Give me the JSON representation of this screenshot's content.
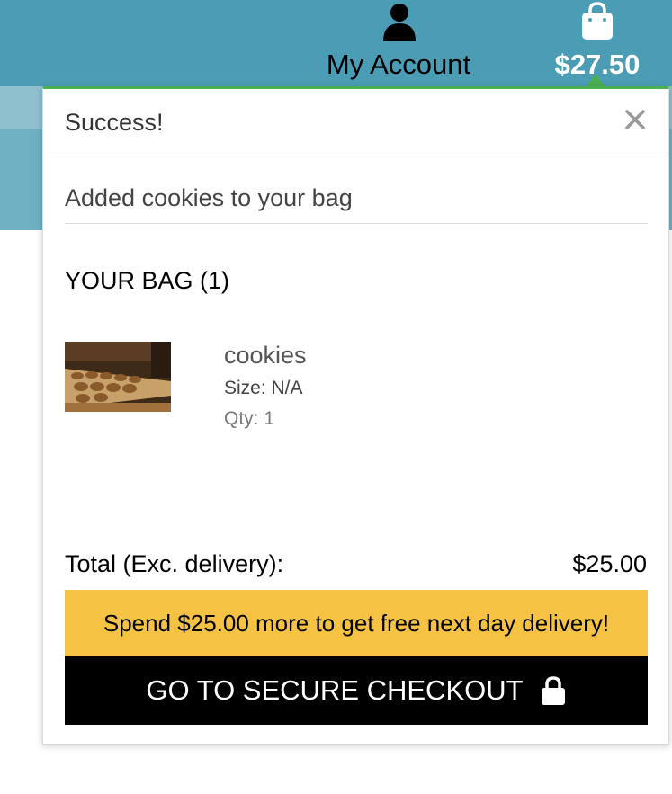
{
  "header": {
    "account_label": "My Account",
    "account_icon": "user-icon",
    "bag_total": "$27.50",
    "bag_icon": "shopping-bag-icon",
    "background_color": "#4a9db5"
  },
  "toast": {
    "title": "Success!",
    "close_icon": "close-icon",
    "message": "Added cookies to your bag",
    "accent_color": "#4caf50"
  },
  "bag": {
    "heading": "YOUR BAG (1)",
    "items": [
      {
        "name": "cookies",
        "size": "Size: N/A",
        "qty": "Qty: 1",
        "thumbnail": "cookies-product-image"
      }
    ],
    "total_label": "Total (Exc. delivery):",
    "total_value": "$25.00"
  },
  "promo": {
    "text": "Spend $25.00 more to get free next day delivery!",
    "color": "#f6c244"
  },
  "checkout": {
    "label": "GO TO SECURE CHECKOUT",
    "icon": "lock-icon"
  }
}
